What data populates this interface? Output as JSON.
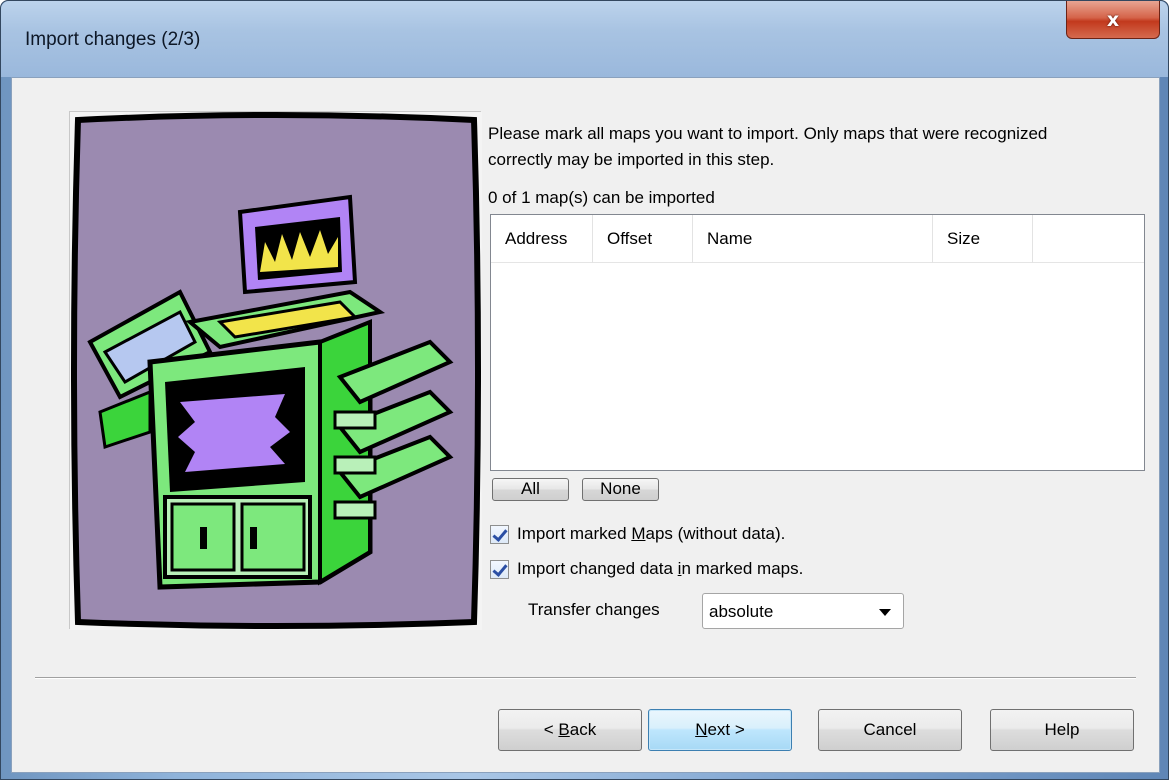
{
  "window": {
    "title": "Import changes (2/3)",
    "close_label": "x"
  },
  "illustration": {
    "icon": "printer-illustration"
  },
  "instructions": "Please mark all maps you want to import. Only maps that were recognized correctly may be imported in this step.",
  "count_label": "0 of 1 map(s) can be imported",
  "list": {
    "columns": [
      "Address",
      "Offset",
      "Name",
      "Size"
    ],
    "rows": []
  },
  "buttons_small": {
    "all": "All",
    "none": "None"
  },
  "options": {
    "import_maps": {
      "label_pre": "Import marked ",
      "label_key": "M",
      "label_post": "aps (without data).",
      "checked": true
    },
    "import_data": {
      "label_pre": "Import changed data ",
      "label_key": "i",
      "label_post": "n marked maps.",
      "checked": true
    }
  },
  "transfer": {
    "label": "Transfer changes",
    "value": "absolute"
  },
  "footer": {
    "back_pre": "< ",
    "back_key": "B",
    "back_post": "ack",
    "next_key": "N",
    "next_post": "ext >",
    "cancel": "Cancel",
    "help": "Help"
  },
  "colors": {
    "picture_bg": "#9b8ab0",
    "printer_green": "#7de87d",
    "accent_purple": "#b184f5"
  }
}
